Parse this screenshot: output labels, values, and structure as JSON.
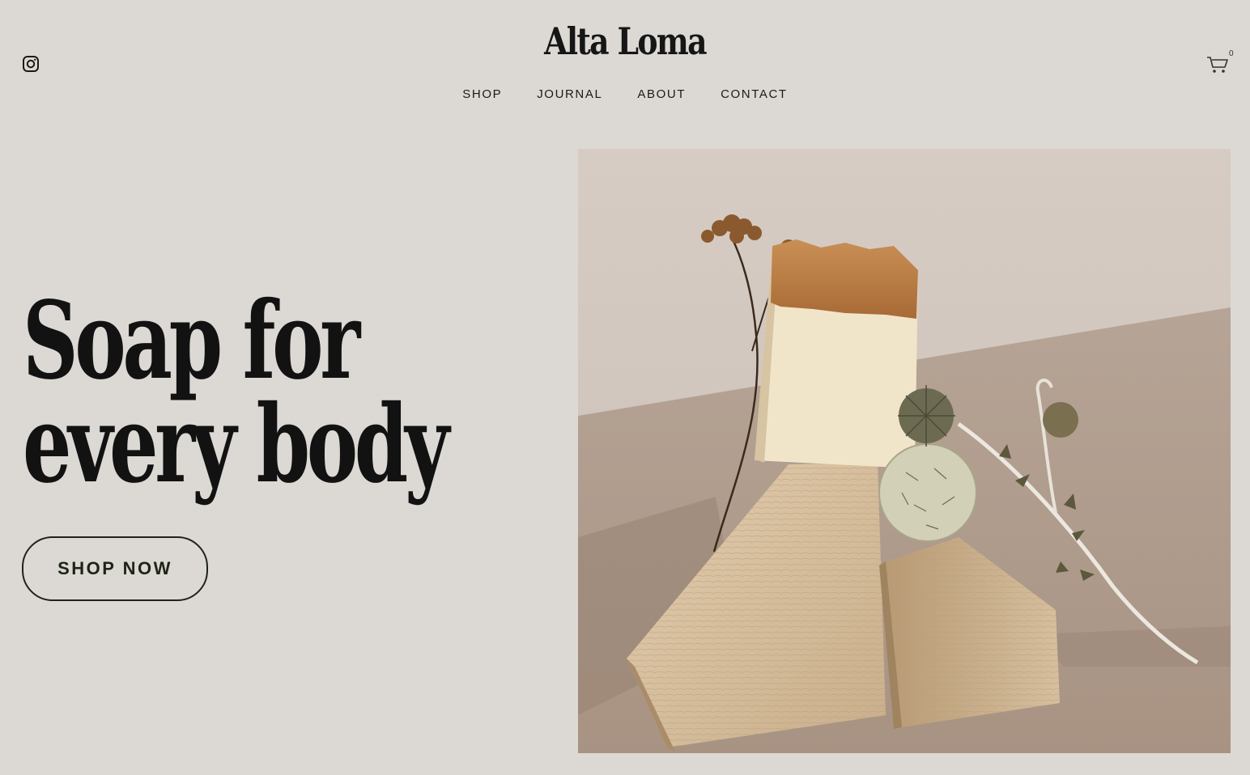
{
  "header": {
    "brand": "Alta Loma",
    "instagram_icon": "instagram-icon",
    "cart_icon": "cart-icon",
    "cart_count": "0",
    "nav": [
      {
        "label": "SHOP"
      },
      {
        "label": "JOURNAL"
      },
      {
        "label": "ABOUT"
      },
      {
        "label": "CONTACT"
      }
    ]
  },
  "hero": {
    "headline_line1": "Soap for",
    "headline_line2": "every body",
    "cta_label": "SHOP NOW"
  },
  "colors": {
    "background": "#dcd9d4",
    "text": "#141414",
    "cta_border": "#1e2415"
  }
}
